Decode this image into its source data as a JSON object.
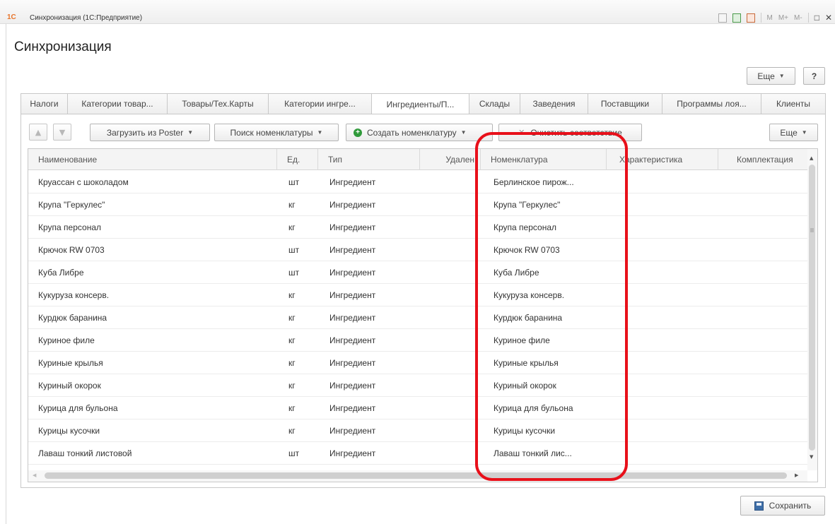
{
  "window": {
    "title": "Синхронизация  (1С:Предприятие)",
    "logo": "1С",
    "tools": [
      "M",
      "M+",
      "M-"
    ]
  },
  "form": {
    "title": "Синхронизация",
    "more_label": "Еще",
    "help_label": "?"
  },
  "tabs": [
    {
      "label": "Налоги",
      "active": false
    },
    {
      "label": "Категории товар...",
      "active": false
    },
    {
      "label": "Товары/Тех.Карты",
      "active": false
    },
    {
      "label": "Категории ингре...",
      "active": false
    },
    {
      "label": "Ингредиенты/П...",
      "active": true
    },
    {
      "label": "Склады",
      "active": false
    },
    {
      "label": "Заведения",
      "active": false
    },
    {
      "label": "Поставщики",
      "active": false
    },
    {
      "label": "Программы лоя...",
      "active": false
    },
    {
      "label": "Клиенты",
      "active": false
    }
  ],
  "toolbar": {
    "load_label": "Загрузить из Poster",
    "search_label": "Поиск номенклатуры",
    "create_label": "Создать номенклатуру",
    "clear_label": "Очистить соответствие",
    "more_label": "Еще"
  },
  "grid": {
    "columns": [
      "Наименование",
      "Ед.",
      "Тип",
      "Удален",
      "Номенклатура",
      "Характеристика",
      "Комплектация"
    ],
    "rows": [
      {
        "name": "Круассан с шоколадом",
        "unit": "шт",
        "type": "Ингредиент",
        "deleted": "",
        "nomenclature": "Берлинское пирож...",
        "characteristic": "",
        "kit": ""
      },
      {
        "name": "Крупа \"Геркулес\"",
        "unit": "кг",
        "type": "Ингредиент",
        "deleted": "",
        "nomenclature": "Крупа \"Геркулес\"",
        "characteristic": "",
        "kit": ""
      },
      {
        "name": "Крупа персонал",
        "unit": "кг",
        "type": "Ингредиент",
        "deleted": "",
        "nomenclature": "Крупа персонал",
        "characteristic": "",
        "kit": ""
      },
      {
        "name": "Крючок RW 0703",
        "unit": "шт",
        "type": "Ингредиент",
        "deleted": "",
        "nomenclature": "Крючок RW 0703",
        "characteristic": "",
        "kit": ""
      },
      {
        "name": "Куба Либре",
        "unit": "шт",
        "type": "Ингредиент",
        "deleted": "",
        "nomenclature": "Куба Либре",
        "characteristic": "",
        "kit": ""
      },
      {
        "name": "Кукуруза консерв.",
        "unit": "кг",
        "type": "Ингредиент",
        "deleted": "",
        "nomenclature": "Кукуруза консерв.",
        "characteristic": "",
        "kit": ""
      },
      {
        "name": "Курдюк баранина",
        "unit": "кг",
        "type": "Ингредиент",
        "deleted": "",
        "nomenclature": "Курдюк баранина",
        "characteristic": "",
        "kit": ""
      },
      {
        "name": "Куриное филе",
        "unit": "кг",
        "type": "Ингредиент",
        "deleted": "",
        "nomenclature": "Куриное филе",
        "characteristic": "",
        "kit": ""
      },
      {
        "name": "Куриные крылья",
        "unit": "кг",
        "type": "Ингредиент",
        "deleted": "",
        "nomenclature": "Куриные крылья",
        "characteristic": "",
        "kit": ""
      },
      {
        "name": "Куриный окорок",
        "unit": "кг",
        "type": "Ингредиент",
        "deleted": "",
        "nomenclature": "Куриный окорок",
        "characteristic": "",
        "kit": ""
      },
      {
        "name": "Курица для бульона",
        "unit": "кг",
        "type": "Ингредиент",
        "deleted": "",
        "nomenclature": "Курица для бульона",
        "characteristic": "",
        "kit": ""
      },
      {
        "name": "Курицы кусочки",
        "unit": "кг",
        "type": "Ингредиент",
        "deleted": "",
        "nomenclature": "Курицы кусочки",
        "characteristic": "",
        "kit": ""
      },
      {
        "name": "Лаваш тонкий листовой",
        "unit": "шт",
        "type": "Ингредиент",
        "deleted": "",
        "nomenclature": "Лаваш тонкий лис...",
        "characteristic": "",
        "kit": ""
      }
    ]
  },
  "footer": {
    "save_label": "Сохранить"
  },
  "colors": {
    "highlight": "#e8101a",
    "accent_green": "#2f9a3a",
    "save_icon": "#3d6ea8"
  }
}
